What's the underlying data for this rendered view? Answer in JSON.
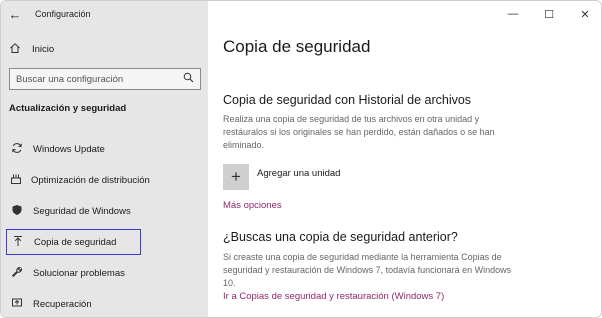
{
  "titlebar": {
    "back_glyph": "←",
    "app_title": "Configuración",
    "minimize_glyph": "—",
    "maximize_glyph": "☐",
    "close_glyph": "✕"
  },
  "sidebar": {
    "home": {
      "label": "Inicio",
      "icon": "home-icon"
    },
    "search": {
      "placeholder": "Buscar una configuración",
      "icon": "search-icon"
    },
    "section_heading": "Actualización y seguridad",
    "items": [
      {
        "label": "Windows Update",
        "icon": "sync-icon",
        "active": false
      },
      {
        "label": "Optimización de distribución",
        "icon": "delivery-icon",
        "active": false
      },
      {
        "label": "Seguridad de Windows",
        "icon": "shield-icon",
        "active": false
      },
      {
        "label": "Copia de seguridad",
        "icon": "backup-upload-icon",
        "active": true
      },
      {
        "label": "Solucionar problemas",
        "icon": "wrench-icon",
        "active": false
      },
      {
        "label": "Recuperación",
        "icon": "recovery-icon",
        "active": false
      }
    ]
  },
  "main": {
    "title": "Copia de seguridad",
    "file_history": {
      "title": "Copia de seguridad con Historial de archivos",
      "description": "Realiza una copia de seguridad de tus archivos en otra unidad y restáuralos si los originales se han perdido, están dañados o se han eliminado.",
      "add_drive_label": "Agregar una unidad",
      "more_options": "Más opciones"
    },
    "older_backup": {
      "title": "¿Buscas una copia de seguridad anterior?",
      "description": "Si creaste una copia de seguridad mediante la herramienta Copias de seguridad y restauración de Windows 7, todavía funcionará en Windows 10.",
      "link": "Ir a Copias de seguridad y restauración (Windows 7)"
    }
  },
  "colors": {
    "sidebar_bg": "#e6e6e6",
    "link": "#8e2a6b",
    "active_border": "#3b3bd6"
  }
}
